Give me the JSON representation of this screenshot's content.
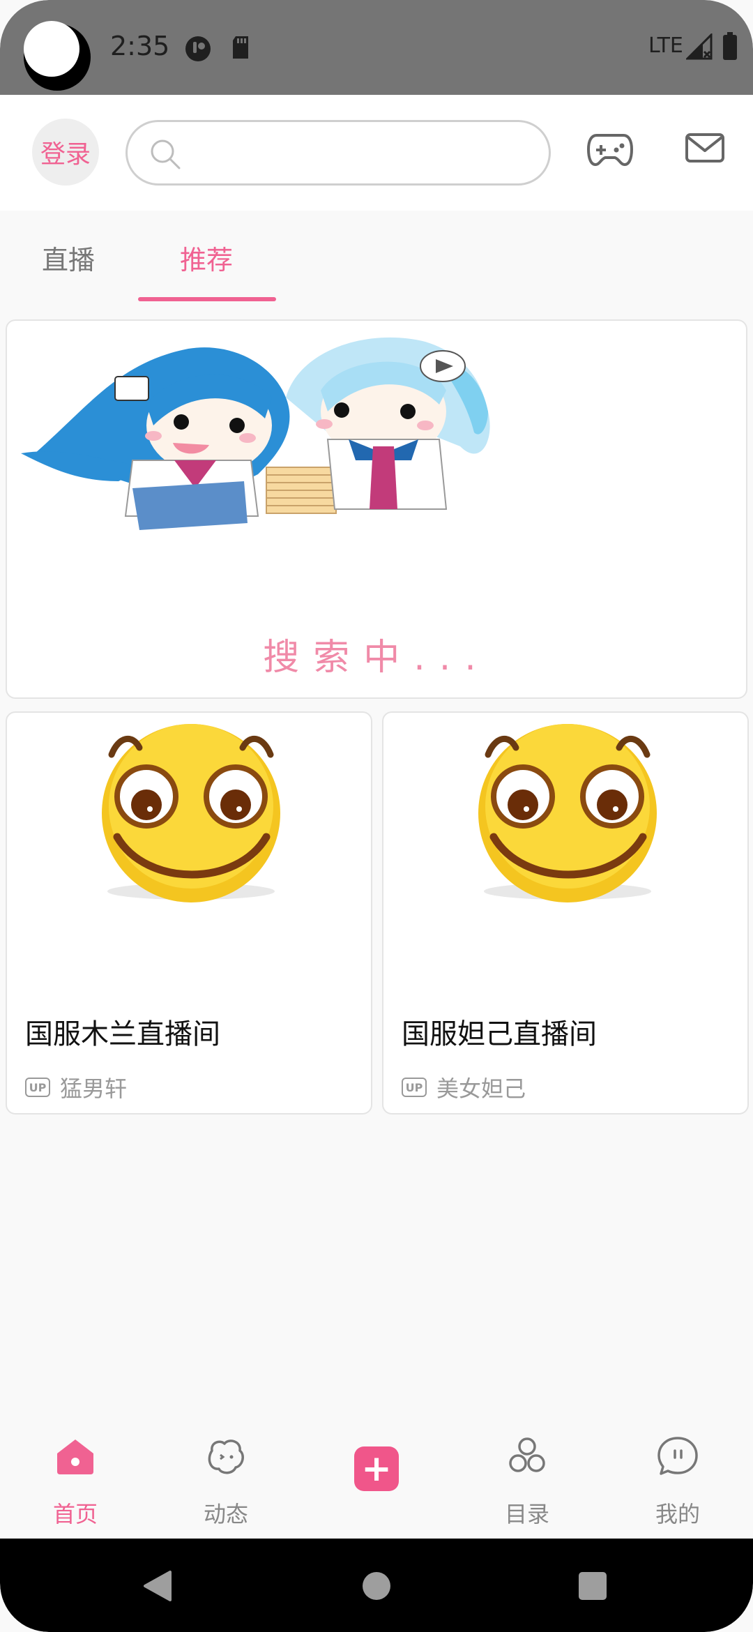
{
  "status_bar": {
    "time": "2:35",
    "network": "LTE",
    "icons": [
      "notification-app-icon",
      "sd-card-icon",
      "signal-icon",
      "battery-icon"
    ]
  },
  "app_bar": {
    "login_label": "登录",
    "search_placeholder": "",
    "icons": [
      "search-icon",
      "gamepad-icon",
      "mail-icon"
    ]
  },
  "tabs": [
    {
      "label": "直播",
      "active": false
    },
    {
      "label": "推荐",
      "active": true
    }
  ],
  "banner": {
    "caption": "搜索中..."
  },
  "cards": [
    {
      "title": "国服木兰直播间",
      "badge": "UP",
      "uploader": "猛男轩"
    },
    {
      "title": "国服妲己直播间",
      "badge": "UP",
      "uploader": "美女妲己"
    }
  ],
  "bottom_nav": [
    {
      "label": "首页",
      "icon": "home-icon",
      "active": true
    },
    {
      "label": "动态",
      "icon": "dynamic-icon",
      "active": false
    },
    {
      "label": "",
      "icon": "add-icon",
      "active": false
    },
    {
      "label": "目录",
      "icon": "category-icon",
      "active": false
    },
    {
      "label": "我的",
      "icon": "chat-bubble-icon",
      "active": false
    }
  ],
  "colors": {
    "accent": "#f06292",
    "status_bar": "#757575",
    "background": "#f9f9f9"
  }
}
